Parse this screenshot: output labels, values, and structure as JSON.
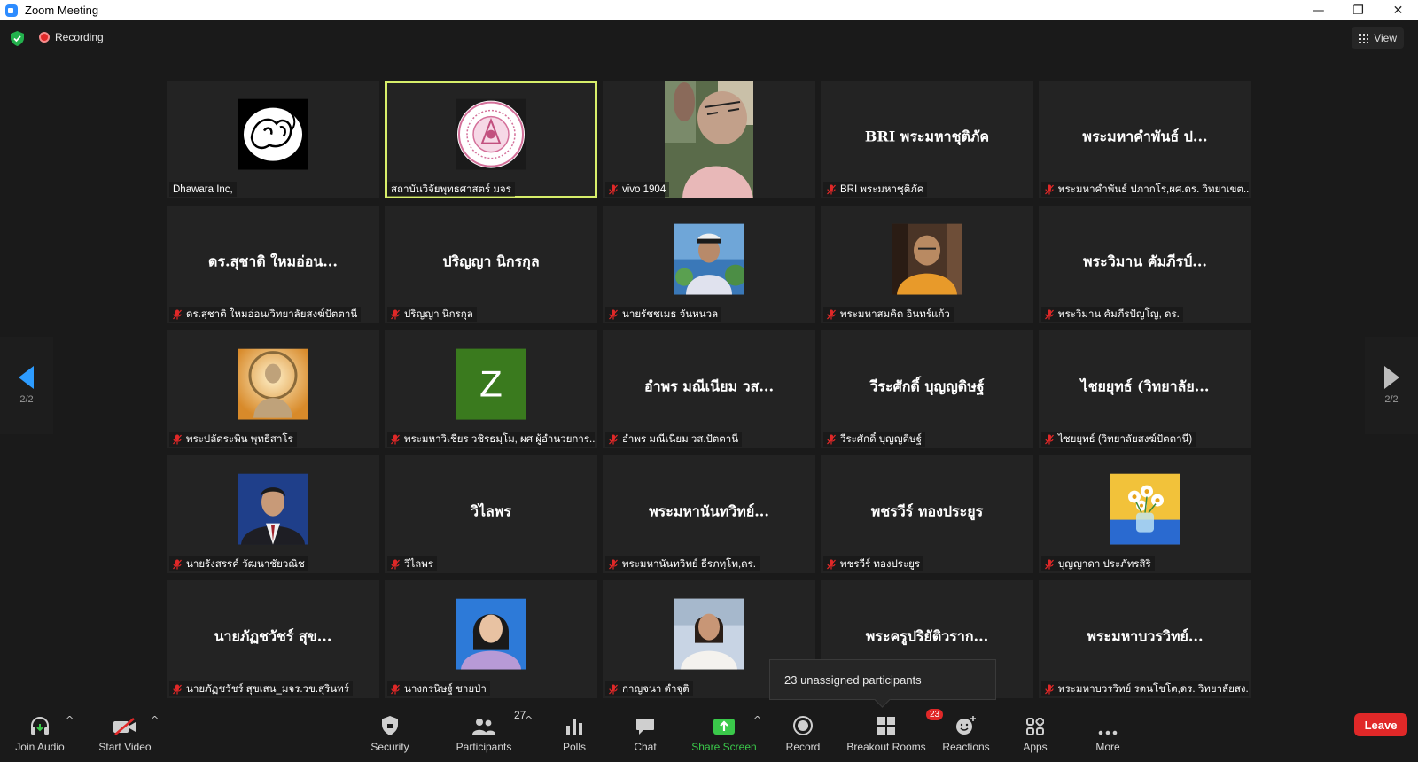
{
  "window": {
    "title": "Zoom Meeting",
    "controls": [
      "—",
      "❐",
      "✕"
    ]
  },
  "topbar": {
    "recording_label": "Recording",
    "view_label": "View"
  },
  "nav": {
    "page_left": "2/2",
    "page_right": "2/2"
  },
  "participants": [
    {
      "label": "Dhawara Inc,",
      "big": "",
      "pic": "logo-dhawara",
      "muted": false,
      "active": false
    },
    {
      "label": "สถาบันวิจัยพุทธศาสตร์ มจร",
      "big": "",
      "pic": "logo-institute",
      "muted": false,
      "active": true
    },
    {
      "label": "vivo 1904",
      "big": "",
      "pic": "video",
      "muted": true,
      "active": false
    },
    {
      "label": "BRI พระมหาชุติภัค",
      "big": "BRI พระมหาชุติภัค",
      "pic": "",
      "muted": true,
      "active": false
    },
    {
      "label": "พระมหาคำพันธ์ ปภากโร,ผศ.ดร. วิทยาเขต...",
      "big": "พระมหาคำพันธ์ ป...",
      "pic": "",
      "muted": true,
      "active": false
    },
    {
      "label": "ดร.สุชาติ ใหมอ่อน/วิทยาลัยสงฆ์ปัตตานี",
      "big": "ดร.สุชาติ ใหมอ่อน...",
      "pic": "",
      "muted": true,
      "active": false
    },
    {
      "label": "ปริญญา นิกรกุล",
      "big": "ปริญญา นิกรกุล",
      "pic": "",
      "muted": true,
      "active": false
    },
    {
      "label": "นายรัชชเมธ จันหนวล",
      "big": "",
      "pic": "uniform",
      "muted": true,
      "active": false
    },
    {
      "label": "พระมหาสมคิด อินทร์แก้ว",
      "big": "",
      "pic": "monk",
      "muted": true,
      "active": false
    },
    {
      "label": "พระวิมาน คัมภีรปัญโญ, ดร.",
      "big": "พระวิมาน คัมภีรป์...",
      "pic": "",
      "muted": true,
      "active": false
    },
    {
      "label": "พระปลัดระพิน พุทธิสาโร",
      "big": "",
      "pic": "buddha",
      "muted": true,
      "active": false
    },
    {
      "label": "พระมหาวิเชียร วชิรธมฺโม, ผศ ผู้อำนวยการ...",
      "big": "",
      "pic": "letter-z",
      "letter": "Z",
      "muted": true,
      "active": false
    },
    {
      "label": "อำพร มณีเนียม วส.ปัตตานี",
      "big": "อำพร มณีเนียม วส...",
      "pic": "",
      "muted": true,
      "active": false
    },
    {
      "label": "วีระศักดิ์ บุญญดิษฐ์",
      "big": "วีระศักดิ์ บุญญดิษฐ์",
      "pic": "",
      "muted": true,
      "active": false
    },
    {
      "label": "ไชยยุทธ์ (วิทยาลัยสงฆ์ปัตตานี)",
      "big": "ไชยยุทธ์ (วิทยาลัย...",
      "pic": "",
      "muted": true,
      "active": false
    },
    {
      "label": "นายรังสรรค์ วัฒนาชัยวณิช",
      "big": "",
      "pic": "suit",
      "muted": true,
      "active": false
    },
    {
      "label": "วิไลพร",
      "big": "วิไลพร",
      "pic": "",
      "muted": true,
      "active": false
    },
    {
      "label": "พระมหานันทวิทย์ ธีรภทฺโท,ดร.",
      "big": "พระมหานันทวิทย์...",
      "pic": "",
      "muted": true,
      "active": false
    },
    {
      "label": "พชรวีร์ ทองประยูร",
      "big": "พชรวีร์ ทองประยูร",
      "pic": "",
      "muted": true,
      "active": false
    },
    {
      "label": "บุญญาดา ประภัทรสิริ",
      "big": "",
      "pic": "flowers",
      "muted": true,
      "active": false
    },
    {
      "label": "นายภัฏชวัชร์ สุขเสน_มจร.วข.สุรินทร์",
      "big": "นายภัฏชวัชร์ สุข...",
      "pic": "",
      "muted": true,
      "active": false
    },
    {
      "label": "นางกรนิษฐ์ ชายป่า",
      "big": "",
      "pic": "woman",
      "muted": true,
      "active": false
    },
    {
      "label": "กาญจนา ดำจุติ",
      "big": "",
      "pic": "woman2",
      "muted": true,
      "active": false
    },
    {
      "label": "",
      "big": "พระครูปริยัติวราก...",
      "pic": "",
      "muted": true,
      "active": false
    },
    {
      "label": "พระมหาบวรวิทย์ รตนโชโต,ดร. วิทยาลัยสง...",
      "big": "พระมหาบวรวิทย์...",
      "pic": "",
      "muted": true,
      "active": false
    }
  ],
  "tooltip": {
    "text": "23 unassigned participants"
  },
  "toolbar": {
    "join_audio": "Join Audio",
    "start_video": "Start Video",
    "security": "Security",
    "participants": "Participants",
    "participants_count": "27",
    "polls": "Polls",
    "chat": "Chat",
    "share_screen": "Share Screen",
    "record": "Record",
    "breakout_rooms": "Breakout Rooms",
    "breakout_badge": "23",
    "reactions": "Reactions",
    "apps": "Apps",
    "more": "More",
    "leave": "Leave"
  },
  "colors": {
    "accent_green": "#3ac94a",
    "leave_red": "#e02828",
    "active_border": "#d7ee6a",
    "nav_blue": "#2d9cff"
  }
}
